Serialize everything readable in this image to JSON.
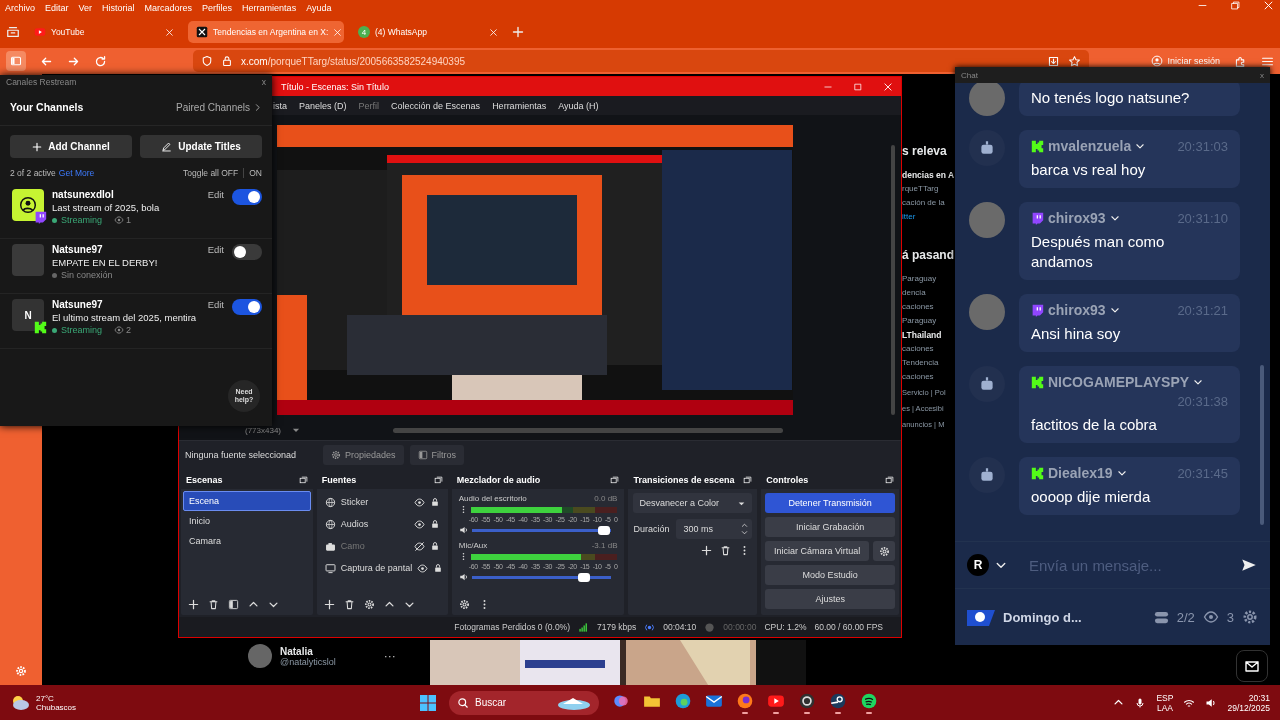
{
  "browser": {
    "menu": [
      "Archivo",
      "Editar",
      "Ver",
      "Historial",
      "Marcadores",
      "Perfiles",
      "Herramientas",
      "Ayuda"
    ],
    "tabs": [
      {
        "kind": "youtube",
        "title": "YouTube",
        "selected": false
      },
      {
        "kind": "x",
        "title": "Tendencias en Argentina en X:",
        "selected": true
      },
      {
        "kind": "whatsapp",
        "badge": "4",
        "title": "(4) WhatsApp",
        "selected": false
      }
    ],
    "url_host": "x.com",
    "url_path": "/porqueTTarg/status/2005663582524940395",
    "sign_in": "Iniciar sesión"
  },
  "page": {
    "fragments": [
      {
        "kind": "heading",
        "text": "s releva"
      },
      {
        "kind": "bold",
        "text": "dencias en A"
      },
      {
        "kind": "muted",
        "text": "rqueTTarg"
      },
      {
        "kind": "muted",
        "text": "cación de la"
      },
      {
        "kind": "link",
        "text": "itter"
      },
      {
        "kind": "heading",
        "text": "á pasand"
      },
      {
        "kind": "muted",
        "text": "Paraguay"
      },
      {
        "kind": "muted",
        "text": "dencia"
      },
      {
        "kind": "muted",
        "text": "caciones"
      },
      {
        "kind": "muted",
        "text": "Paraguay"
      },
      {
        "kind": "bold",
        "text": "LThailand"
      },
      {
        "kind": "muted",
        "text": "caciones"
      },
      {
        "kind": "muted",
        "text": "Tendencia"
      },
      {
        "kind": "muted",
        "text": "caciones"
      },
      {
        "kind": "footer",
        "text": "Servicio | Pol"
      },
      {
        "kind": "footer",
        "text": "es | Accesibi"
      },
      {
        "kind": "footer",
        "text": "anuncios | M"
      }
    ],
    "post": {
      "name": "Natalia",
      "handle": "@natalyticslol",
      "more": "···"
    }
  },
  "restream": {
    "title": "Canales Restream",
    "close": "x",
    "heading": "Your Channels",
    "paired": "Paired Channels",
    "add": "Add Channel",
    "update": "Update Titles",
    "active": "2 of 2 active",
    "get_more": "Get More",
    "toggle_off": "Toggle all OFF",
    "toggle_on": "ON",
    "help": "Need help?",
    "channels": [
      {
        "kind": "twitch",
        "name": "natsunexdlol",
        "title": "Last stream of 2025, bola",
        "live": true,
        "status": "Streaming",
        "viewers": "1",
        "edit": "Edit",
        "on": true
      },
      {
        "name": "Natsune97",
        "title": "EMPATE EN EL DERBY!",
        "live": false,
        "status": "Sin conexión",
        "edit": "Edit",
        "on": false
      },
      {
        "kind": "kick",
        "initial": "N",
        "name": "Natsune97",
        "title": "El ultimo stream del 2025, mentira",
        "live": true,
        "status": "Streaming",
        "viewers": "2",
        "edit": "Edit",
        "on": true
      }
    ]
  },
  "obs": {
    "title": "Título - Escenas: Sin Título",
    "menu": [
      {
        "label": "ista",
        "disabled": false
      },
      {
        "label": "Paneles (D)",
        "disabled": false
      },
      {
        "label": "Perfil",
        "disabled": true
      },
      {
        "label": "Colección de Escenas",
        "disabled": false
      },
      {
        "label": "Herramientas",
        "disabled": false
      },
      {
        "label": "Ayuda (H)",
        "disabled": false
      }
    ],
    "resolution": "(773x434)",
    "no_source": "Ninguna fuente seleccionad",
    "properties": "Propiedades",
    "filters": "Filtros",
    "scenes": {
      "title": "Escenas",
      "items": [
        {
          "name": "Escena",
          "selected": true
        },
        {
          "name": "Inicio",
          "selected": false
        },
        {
          "name": "Camara",
          "selected": false
        }
      ]
    },
    "sources": {
      "title": "Fuentes",
      "items": [
        {
          "kind": "globe",
          "name": "Sticker",
          "visible": true
        },
        {
          "kind": "globe",
          "name": "Audios",
          "visible": true
        },
        {
          "kind": "camera",
          "name": "Camo",
          "visible": false
        },
        {
          "kind": "monitor",
          "name": "Captura de pantal",
          "visible": true
        }
      ]
    },
    "mixer": {
      "title": "Mezclador de audio",
      "channels": [
        {
          "name": "Audio del escritorio",
          "reading": "0.0 dB",
          "meter": {
            "level": 0.62
          },
          "volume": {
            "level": 0.95
          },
          "ticks": [
            "-60",
            "-55",
            "-50",
            "-45",
            "-40",
            "-35",
            "-30",
            "-25",
            "-20",
            "-15",
            "-10",
            "-5",
            "0"
          ]
        },
        {
          "name": "Mic/Aux",
          "reading": "-3.1 dB",
          "meter": {
            "level": 0.75
          },
          "volume": {
            "level": 0.8
          },
          "ticks": [
            "-60",
            "-55",
            "-50",
            "-45",
            "-40",
            "-35",
            "-30",
            "-25",
            "-20",
            "-15",
            "-10",
            "-5",
            "0"
          ]
        }
      ]
    },
    "transitions": {
      "title": "Transiciones de escena",
      "selected": "Desvanecer a Color",
      "duration_label": "Duración",
      "duration": "300 ms"
    },
    "controls": {
      "title": "Controles",
      "buttons": [
        {
          "label": "Detener Transmisión",
          "kind": "plain",
          "active": true
        },
        {
          "label": "Iniciar Grabación",
          "kind": "plain",
          "active": false
        },
        {
          "label": "Iniciar Cámara Virtual",
          "kind": "with_settings",
          "active": false
        },
        {
          "label": "Modo Estudio",
          "kind": "plain",
          "active": false
        },
        {
          "label": "Ajustes",
          "kind": "plain",
          "active": false
        }
      ]
    },
    "status": {
      "dropped": "Fotogramas Perdidos 0 (0.0%)",
      "bitrate": "7179 kbps",
      "stream_time": "00:04:10",
      "record_time": "00:00:00",
      "cpu": "CPU: 1.2%",
      "fps": "60.00 / 60.00 FPS"
    }
  },
  "chat": {
    "title": "Chat",
    "close": "x",
    "messages": [
      {
        "kind": "twitch",
        "text": "No tenés logo natsune?"
      },
      {
        "kind": "kick",
        "author": "mvalenzuela",
        "time": "20:31:03",
        "text": "barca vs real hoy"
      },
      {
        "kind": "twitch",
        "author": "chirox93",
        "time": "20:31:10",
        "text": "Después man como andamos"
      },
      {
        "kind": "twitch",
        "author": "chirox93",
        "time": "20:31:21",
        "text": "Ansi hina soy"
      },
      {
        "kind": "kick",
        "author": "NICOGAMEPLAYSPY",
        "time": "20:31:38",
        "text": "factitos de la cobra"
      },
      {
        "kind": "kick",
        "author": "Diealex19",
        "time": "20:31:45",
        "text": "oooop dije mierda"
      }
    ],
    "account": "R",
    "placeholder": "Envía un mensaje...",
    "stream_name": "Domingo d...",
    "channels": "2/2",
    "viewers": "3"
  },
  "taskbar": {
    "temp": "27°C",
    "weather": "Chubascos",
    "search": "Buscar",
    "apps": [
      {
        "kind": "copilot",
        "running": false
      },
      {
        "kind": "files",
        "running": false
      },
      {
        "kind": "edge",
        "running": false
      },
      {
        "kind": "outlook",
        "running": false
      },
      {
        "kind": "firefox",
        "running": true
      },
      {
        "kind": "youtube",
        "running": true
      },
      {
        "kind": "obs",
        "running": true
      },
      {
        "kind": "steam",
        "running": true
      },
      {
        "kind": "spotify",
        "running": true
      }
    ],
    "lang": "ESP",
    "layout": "LAA",
    "time": "20:31",
    "date": "29/12/2025"
  }
}
